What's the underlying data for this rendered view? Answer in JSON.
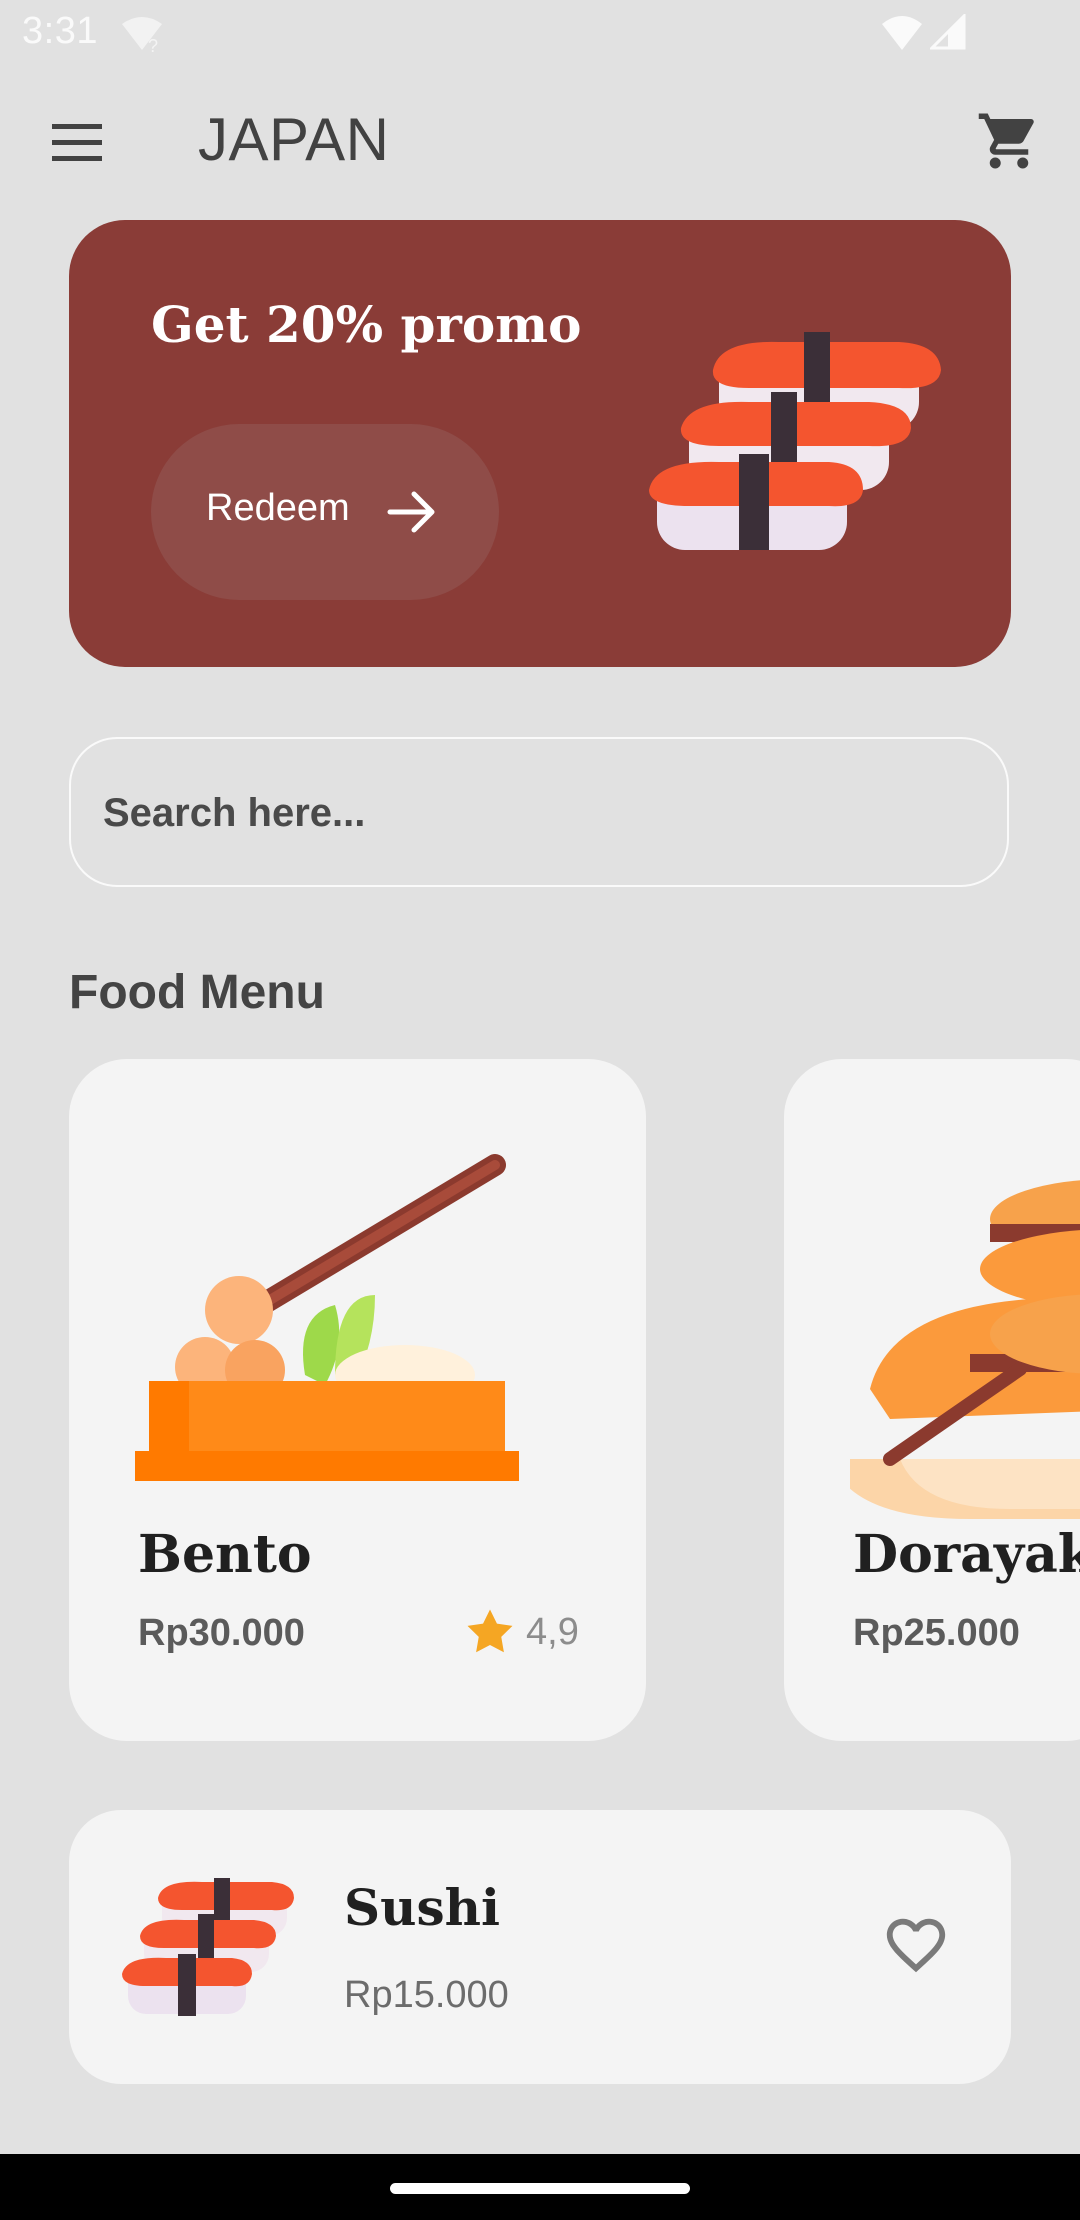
{
  "status_bar": {
    "time": "3:31",
    "wifi_q": "?"
  },
  "app_bar": {
    "title": "JAPAN",
    "icons": [
      "menu-icon",
      "cart-icon"
    ]
  },
  "promo": {
    "title": "Get 20% promo",
    "button_label": "Redeem"
  },
  "search": {
    "placeholder": "Search here..."
  },
  "food_menu": {
    "title": "Food Menu",
    "cards": [
      {
        "name": "Bento",
        "price": "Rp30.000",
        "rating": "4,9"
      },
      {
        "name": "Dorayaki",
        "price": "Rp25.000"
      }
    ]
  },
  "list": [
    {
      "name": "Sushi",
      "price": "Rp15.000"
    }
  ],
  "colors": {
    "background": "#e1e1e1",
    "promo_bg": "#8a3c37",
    "card_bg": "#f4f4f4",
    "star": "#f5a623"
  }
}
